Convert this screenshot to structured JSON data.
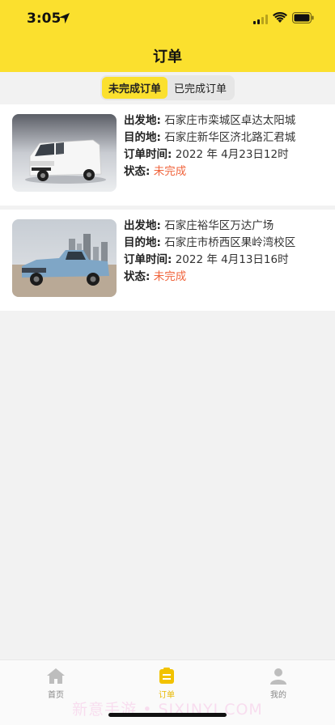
{
  "status_bar": {
    "time": "3:05"
  },
  "header": {
    "title": "订单"
  },
  "segments": [
    {
      "label": "未完成订单",
      "active": true
    },
    {
      "label": "已完成订单",
      "active": false
    }
  ],
  "orders": [
    {
      "from_label": "出发地:",
      "from": "石家庄市栾城区卓达太阳城",
      "to_label": "目的地:",
      "to": "石家庄新华区济北路汇君城",
      "time_label": "订单时间:",
      "time": "2022 年 4月23日12时",
      "status_label": "状态:",
      "status": "未完成",
      "image": "white-van"
    },
    {
      "from_label": "出发地:",
      "from": "石家庄裕华区万达广场",
      "to_label": "目的地:",
      "to": "石家庄市桥西区果岭湾校区",
      "time_label": "订单时间:",
      "time": "2022 年 4月13日16时",
      "status_label": "状态:",
      "status": "未完成",
      "image": "blue-pickup-truck"
    }
  ],
  "tabbar": [
    {
      "label": "首页",
      "icon": "home-icon",
      "active": false
    },
    {
      "label": "订单",
      "icon": "order-icon",
      "active": true
    },
    {
      "label": "我的",
      "icon": "profile-icon",
      "active": false
    }
  ],
  "watermark": "新意手游 • SIXINYI.COM",
  "colors": {
    "accent": "#fbe02e",
    "status": "#f0643c",
    "background": "#f2f2f2"
  }
}
